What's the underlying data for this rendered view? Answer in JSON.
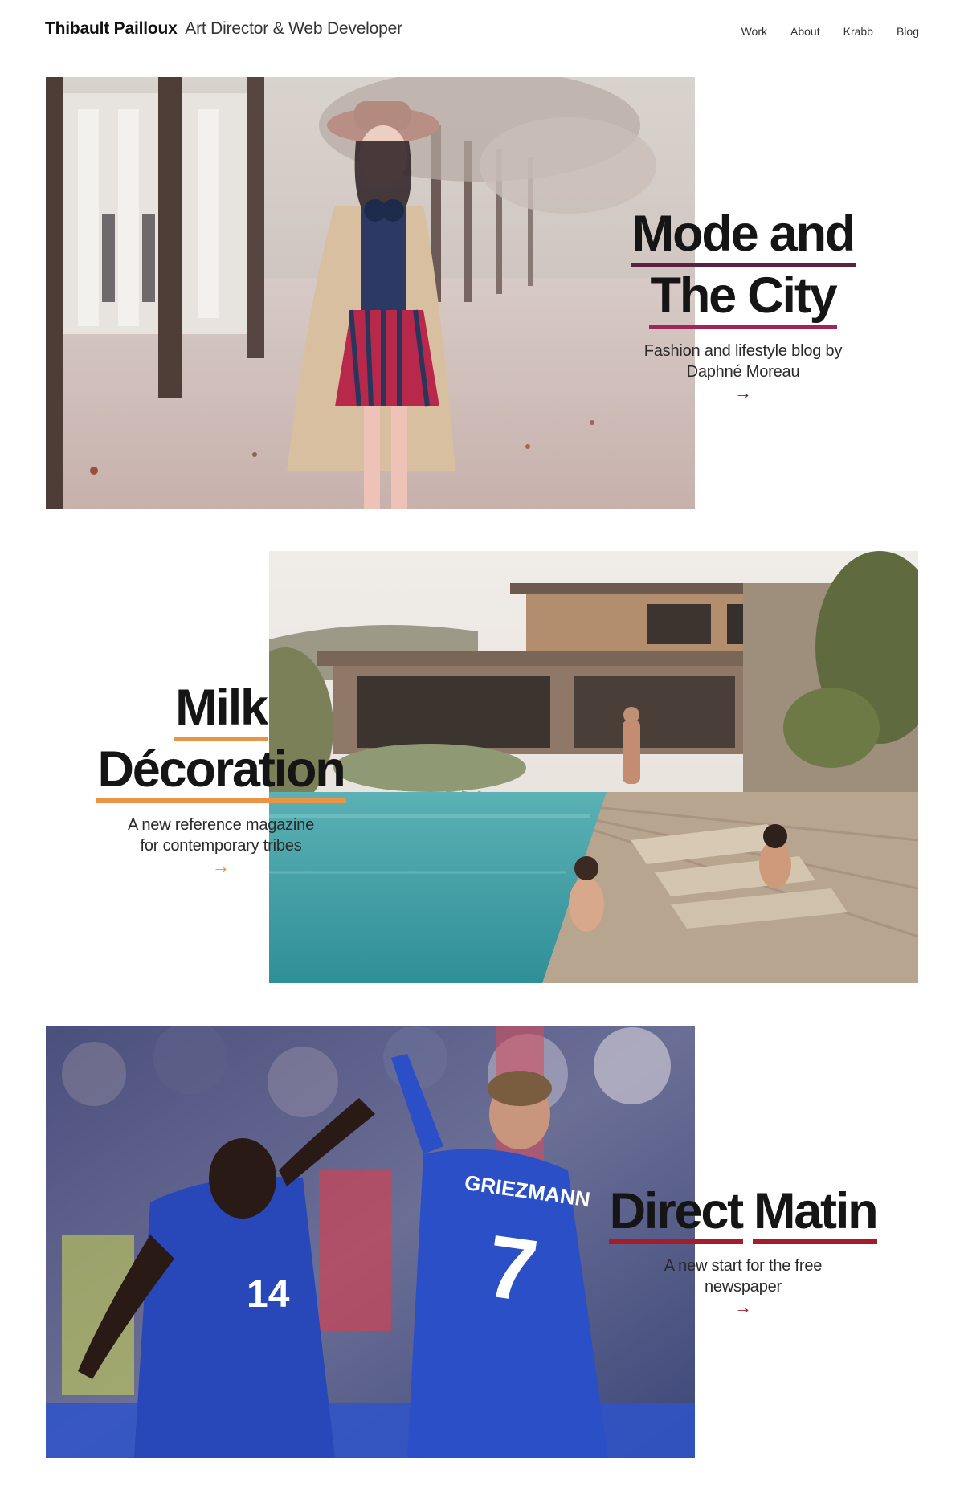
{
  "header": {
    "brand_name": "Thibault Pailloux",
    "brand_role": "Art Director & Web Developer",
    "nav": [
      {
        "label": "Work"
      },
      {
        "label": "About"
      },
      {
        "label": "Krabb"
      },
      {
        "label": "Blog"
      }
    ]
  },
  "projects": [
    {
      "title_line_1": "Mode and",
      "title_line_2": "The City",
      "description_line_1": "Fashion and lifestyle blog by",
      "description_line_2": "Daphné Moreau",
      "arrow": "→",
      "accent_colors": [
        "#5a2240",
        "#a2245a"
      ]
    },
    {
      "title_line_1": "Milk",
      "title_line_2": "Décoration",
      "description_line_1": "A new reference magazine",
      "description_line_2": "for contemporary tribes",
      "arrow": "→",
      "accent_colors": [
        "#ec9445"
      ]
    },
    {
      "title_word_1": "Direct",
      "title_word_2": "Matin",
      "description_line_1": "A new start for the free",
      "description_line_2": "newspaper",
      "arrow": "→",
      "accent_colors": [
        "#a61c2a"
      ],
      "photo_text_jersey_name": "GRIEZMANN",
      "photo_text_jersey_number_back": "7",
      "photo_text_jersey_number_front": "14"
    }
  ]
}
